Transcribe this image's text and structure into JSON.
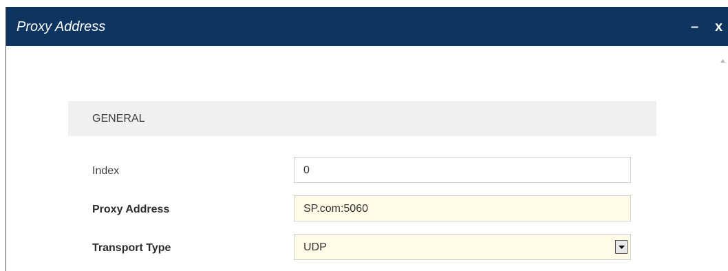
{
  "dialog": {
    "title": "Proxy Address",
    "minimize_label": "–",
    "close_label": "x"
  },
  "section": {
    "title": "GENERAL"
  },
  "fields": [
    {
      "label": "Index",
      "value": "0",
      "mandatory": false
    },
    {
      "label": "Proxy Address",
      "value": "SP.com:5060",
      "mandatory": true
    },
    {
      "label": "Transport Type",
      "value": "UDP",
      "mandatory": true
    }
  ],
  "colors": {
    "titlebar": "#0e3560",
    "mandatory_field": "#fffbe6",
    "section_header": "#f0f0f0"
  },
  "icons": [
    "scroll-up-icon",
    "dropdown-arrow-icon"
  ]
}
